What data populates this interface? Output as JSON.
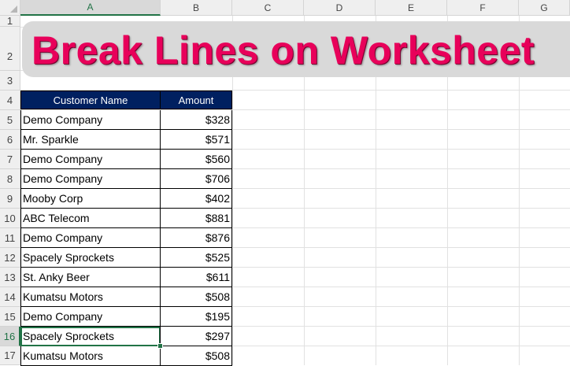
{
  "columns": [
    "A",
    "B",
    "C",
    "D",
    "E",
    "F",
    "G"
  ],
  "rows": [
    "1",
    "2",
    "3",
    "4",
    "5",
    "6",
    "7",
    "8",
    "9",
    "10",
    "11",
    "12",
    "13",
    "14",
    "15",
    "16",
    "17"
  ],
  "title": "Break Lines on Worksheet",
  "table": {
    "headers": [
      "Customer Name",
      "Amount"
    ],
    "records": [
      {
        "name": "Demo Company",
        "amount": "$328"
      },
      {
        "name": "Mr. Sparkle",
        "amount": "$571"
      },
      {
        "name": "Demo Company",
        "amount": "$560"
      },
      {
        "name": "Demo Company",
        "amount": "$706"
      },
      {
        "name": "Mooby Corp",
        "amount": "$402"
      },
      {
        "name": "ABC Telecom",
        "amount": "$881"
      },
      {
        "name": "Demo Company",
        "amount": "$876"
      },
      {
        "name": "Spacely Sprockets",
        "amount": "$525"
      },
      {
        "name": "St. Anky Beer",
        "amount": "$611"
      },
      {
        "name": "Kumatsu Motors",
        "amount": "$508"
      },
      {
        "name": "Demo Company",
        "amount": "$195"
      },
      {
        "name": "Spacely Sprockets",
        "amount": "$297"
      },
      {
        "name": "Kumatsu Motors",
        "amount": "$508"
      }
    ]
  },
  "active_cell": "A16",
  "colors": {
    "header_fill": "#002060",
    "title_color": "#e8005a",
    "banner_fill": "#d9d9d9",
    "selection": "#217346"
  }
}
